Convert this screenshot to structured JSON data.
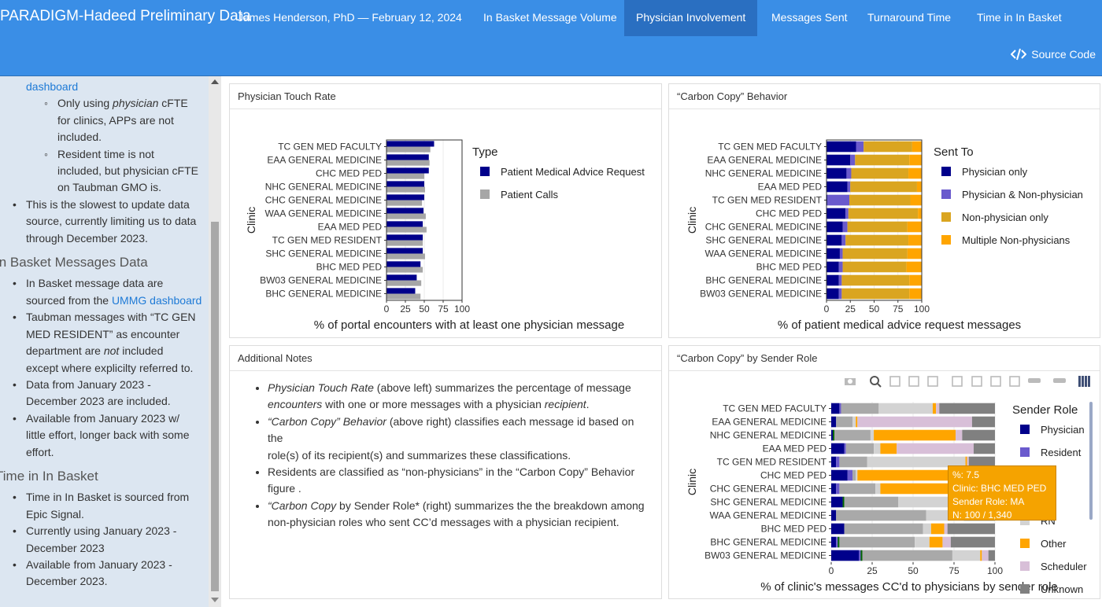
{
  "header": {
    "brand": "PARADIGM-Hadeed Preliminary Data",
    "author": "James Henderson, PhD — February 12, 2024",
    "tabs": [
      {
        "label": "In Basket Message Volume"
      },
      {
        "label": "Physician Involvement"
      },
      {
        "label": "Messages Sent"
      },
      {
        "label": "Turnaround Time"
      },
      {
        "label": "Time in In Basket"
      }
    ],
    "active_tab": "Physician Involvement",
    "source_code": "Source Code",
    "source_icon": "code-icon"
  },
  "sidebar": {
    "intro_link": "dashboard",
    "sub_items_top": [
      [
        "Only using ",
        "physician",
        " cFTE",
        "for clinics, APPs are not",
        "included."
      ],
      [
        "Resident time is not",
        "included, but physician cFTE",
        "on Taubman GMO is."
      ]
    ],
    "item_slowest": [
      "This is the slowest to update data",
      "source, currently limiting us to data",
      "through December 2023."
    ],
    "heading_inbasket": "In Basket Messages Data",
    "inbasket_items": {
      "i1_a": "In Basket message data are",
      "i1_b": "sourced from the ",
      "i1_link": "UMMG dashboard",
      "i2_a": "Taubman messages with “TC GEN",
      "i2_b": "MED RESIDENT” as encounter",
      "i2_c1": "department are ",
      "i2_c_em": "not",
      "i2_c2": " included",
      "i2_d": "except where explicilty referred to.",
      "i3_a": "Data from January 2023 -",
      "i3_b": "December 2023 are included.",
      "i4_a": "Available from January 2023 w/",
      "i4_b": "little effort, longer back with some",
      "i4_c": "effort."
    },
    "heading_time": "Time in In Basket",
    "time_items": {
      "t1_a": "Time in In Basket is sourced from",
      "t1_b": "Epic Signal.",
      "t2_a": "Currently using January 2023 -",
      "t2_b": "December 2023",
      "t3_a": "Available from January 2023 -",
      "t3_b": "December 2023."
    }
  },
  "panels": {
    "touch_title": "Physician Touch Rate",
    "cc_title": "“Carbon Copy” Behavior",
    "notes_title": "Additional Notes",
    "role_title": "“Carbon Copy” by Sender Role"
  },
  "notes": {
    "n1_em": "Physician Touch Rate",
    "n1_a": " (above left) summarizes the percentage of message",
    "n1_em2": "encounters",
    "n1_b": " with one or more messages with a physician ",
    "n1_em3": "recipient",
    "n1_c": ".",
    "n2_em": "“Carbon Copy” Behavior",
    "n2_a": " (above right) classifies each message id based on the",
    "n2_b": "role(s) of its recipient(s) and summarizes these classifications.",
    "n3_a": "Residents are classified as “non-physicians” in the “Carbon Copy” Behavior",
    "n3_b": "figure .",
    "n4_em": "“Carbon Copy",
    "n4_a": " by Sender Role* (right) summarizes the the breakdown among",
    "n4_b": "non-physician roles who sent CC’d messages with a physician recipient."
  },
  "tooltip": {
    "line1": "%:  7.5",
    "line2": "Clinic: BHC MED PED",
    "line3": "Sender Role: MA",
    "line4": "N: 100 / 1,340"
  },
  "modebar_icons": [
    "camera-icon",
    "zoom-icon",
    "pan-icon",
    "box-select-icon",
    "lasso-icon",
    "zoom-in-icon",
    "zoom-out-icon",
    "autoscale-icon",
    "reset-axes-icon",
    "spike-lines-icon",
    "compare-hover-icon",
    "plotly-logo-icon"
  ],
  "chart_data": [
    {
      "type": "bar",
      "orientation": "horizontal",
      "xlabel": "% of portal encounters with at least one physician message",
      "ylabel": "Clinic",
      "xlim": [
        0,
        100
      ],
      "xticks": [
        0,
        25,
        50,
        75,
        100
      ],
      "legend_title": "Type",
      "legend_position": "right",
      "categories": [
        "TC GEN MED FACULTY",
        "EAA GENERAL MEDICINE",
        "CHC MED PED",
        "NHC GENERAL MEDICINE",
        "CHC GENERAL MEDICINE",
        "WAA GENERAL MEDICINE",
        "EAA MED PED",
        "TC GEN MED RESIDENT",
        "SHC GENERAL MEDICINE",
        "BHC MED PED",
        "BW03 GENERAL MEDICINE",
        "BHC GENERAL MEDICINE"
      ],
      "series": [
        {
          "name": "Patient Medical Advice Request",
          "color": "#00008b",
          "values": [
            63,
            56,
            56,
            50,
            50,
            49,
            48,
            48,
            48,
            45,
            40,
            38
          ]
        },
        {
          "name": "Patient Calls",
          "color": "#a6a6a6",
          "values": [
            58,
            57,
            50,
            51,
            47,
            52,
            53,
            48,
            51,
            48,
            46,
            45
          ]
        }
      ]
    },
    {
      "type": "bar",
      "orientation": "horizontal",
      "stacked": true,
      "xlabel": "% of patient medical advice request messages",
      "ylabel": "Clinic",
      "xlim": [
        0,
        100
      ],
      "xticks": [
        0,
        25,
        50,
        75,
        100
      ],
      "legend_title": "Sent To",
      "legend_position": "right",
      "categories": [
        "TC GEN MED FACULTY",
        "EAA GENERAL MEDICINE",
        "NHC GENERAL MEDICINE",
        "EAA MED PED",
        "TC GEN MED RESIDENT",
        "CHC MED PED",
        "CHC GENERAL MEDICINE",
        "SHC GENERAL MEDICINE",
        "WAA GENERAL MEDICINE",
        "BHC MED PED",
        "BHC GENERAL MEDICINE",
        "BW03 GENERAL MEDICINE"
      ],
      "series": [
        {
          "name": "Physician only",
          "color": "#00008b",
          "values": [
            31,
            25,
            21,
            22,
            1,
            20,
            17,
            16,
            14,
            13,
            13,
            13
          ]
        },
        {
          "name": "Physician & Non-physician",
          "color": "#6a5acd",
          "values": [
            8,
            5,
            5,
            3,
            23,
            3,
            5,
            4,
            3,
            4,
            3,
            3
          ]
        },
        {
          "name": "Non-physician only",
          "color": "#daa520",
          "values": [
            51,
            57,
            60,
            70,
            64,
            73,
            63,
            66,
            68,
            67,
            71,
            71
          ]
        },
        {
          "name": "Multiple Non-physicians",
          "color": "#ffa500",
          "values": [
            10,
            13,
            14,
            5,
            12,
            4,
            15,
            14,
            15,
            16,
            13,
            13
          ]
        }
      ]
    },
    {
      "type": "bar",
      "orientation": "horizontal",
      "stacked": true,
      "xlabel": "% of clinic's messages CC'd to physicians by sender role",
      "ylabel": "Clinic",
      "xlim": [
        0,
        100
      ],
      "xticks": [
        0,
        25,
        50,
        75,
        100
      ],
      "legend_title": "Sender Role",
      "legend_position": "right",
      "categories": [
        "TC GEN MED FACULTY",
        "EAA GENERAL MEDICINE",
        "NHC GENERAL MEDICINE",
        "EAA MED PED",
        "TC GEN MED RESIDENT",
        "CHC MED PED",
        "CHC GENERAL MEDICINE",
        "SHC GENERAL MEDICINE",
        "WAA GENERAL MEDICINE",
        "BHC MED PED",
        "BHC GENERAL MEDICINE",
        "BW03 GENERAL MEDICINE"
      ],
      "series": [
        {
          "name": "Physician",
          "color": "#00008b",
          "values": [
            5,
            3,
            1,
            8,
            3,
            10,
            3,
            7,
            3,
            8,
            3,
            17
          ]
        },
        {
          "name": "Resident",
          "color": "#6a5acd",
          "values": [
            1,
            0,
            0,
            1,
            2,
            3,
            2,
            0,
            0,
            0,
            1,
            1
          ]
        },
        {
          "name": "PA",
          "color": "#006400",
          "values": [
            0,
            0,
            1,
            0,
            0,
            0,
            0,
            1,
            0,
            0,
            1,
            1
          ]
        },
        {
          "name": "MA",
          "color": "#a9a9a9",
          "values": [
            23,
            10,
            22,
            17,
            17,
            2,
            22,
            33,
            55,
            48,
            46,
            55
          ]
        },
        {
          "name": "RN",
          "color": "#d3d3d3",
          "values": [
            33,
            2,
            2,
            4,
            60,
            1,
            3,
            45,
            20,
            5,
            9,
            17
          ]
        },
        {
          "name": "Other",
          "color": "#ffa500",
          "values": [
            2,
            1,
            50,
            10,
            1,
            79,
            59,
            0,
            0,
            8,
            8,
            1
          ]
        },
        {
          "name": "Scheduler",
          "color": "#d8bfd8",
          "values": [
            2,
            70,
            4,
            47,
            1,
            1,
            3,
            2,
            3,
            2,
            5,
            4
          ]
        },
        {
          "name": "Unknown",
          "color": "#808080",
          "values": [
            34,
            14,
            20,
            13,
            16,
            4,
            7,
            12,
            19,
            29,
            27,
            4
          ]
        }
      ]
    }
  ]
}
